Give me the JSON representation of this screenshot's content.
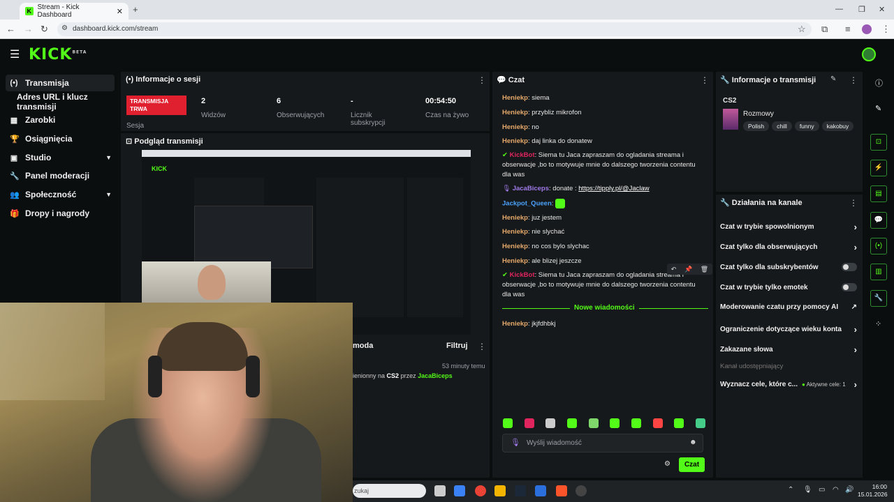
{
  "browser": {
    "tab_title": "Stream - Kick Dashboard",
    "url": "dashboard.kick.com/stream"
  },
  "brand": {
    "logo": "KICK",
    "badge": "BETA",
    "accent": "#53fc18"
  },
  "sidebar": {
    "items": [
      {
        "label": "Transmisja",
        "icon": "broadcast-icon"
      },
      {
        "label": "Adres URL i klucz transmisji"
      },
      {
        "label": "Zarobki",
        "icon": "earnings-icon"
      },
      {
        "label": "Osiągnięcia",
        "icon": "trophy-icon"
      },
      {
        "label": "Studio",
        "icon": "studio-icon"
      },
      {
        "label": "Panel moderacji",
        "icon": "wrench-icon"
      },
      {
        "label": "Społeczność",
        "icon": "people-icon"
      },
      {
        "label": "Dropy i nagrody",
        "icon": "gift-icon"
      }
    ]
  },
  "session": {
    "title": "Informacje o sesji",
    "live_badge": "TRANSMISJA TRWA",
    "session_label": "Sesja",
    "stats": [
      {
        "value": "2",
        "label": "Widzów"
      },
      {
        "value": "6",
        "label": "Obserwujących"
      },
      {
        "value": "-",
        "label": "Licznik subskrypcji"
      },
      {
        "value": "00:54:50",
        "label": "Czas na żywo"
      }
    ]
  },
  "preview": {
    "title": "Podgląd transmisji"
  },
  "feed": {
    "title_fragment": "moda",
    "filter_label": "Filtruj",
    "time": "53 minuty temu",
    "text_pre": "ienionny na ",
    "game": "CS2",
    "mid": " przez ",
    "user": "JacaBiceps"
  },
  "chat": {
    "title": "Czat",
    "messages": [
      {
        "user": "Heniekp",
        "text": "siema"
      },
      {
        "user": "Heniekp",
        "text": "przybliz mikrofon"
      },
      {
        "user": "Heniekp",
        "text": "no"
      },
      {
        "user": "Heniekp",
        "text": "daj linka do donatew"
      },
      {
        "user": "KickBot",
        "text": "Siema tu Jaca zapraszam do ogladania streama i obserwacje ,bo to motywuje mnie do dalszego tworzenia contentu dla was"
      },
      {
        "user": "JacaBiceps",
        "text": "donate :",
        "link": "https://tipply.pl/@Jaclaw"
      },
      {
        "user": "Jackpot_Queen",
        "text": ""
      },
      {
        "user": "Heniekp",
        "text": "juz jestem"
      },
      {
        "user": "Heniekp",
        "text": "nie slychać"
      },
      {
        "user": "Heniekp",
        "text": "no cos bylo slychac"
      },
      {
        "user": "Heniekp",
        "text": "ale blizej jeszcze"
      },
      {
        "user": "KickBot",
        "text": "Siema tu Jaca zapraszam do ogladania streama i obserwacje ,bo to motywuje mnie do dalszego tworzenia contentu dla was"
      },
      {
        "user": "Heniekp",
        "text": "jkjfdhbkj"
      }
    ],
    "new_messages": "Nowe wiadomości",
    "placeholder": "Wyślij wiadomość",
    "send_label": "Czat"
  },
  "stream_info": {
    "title": "Informacje o transmisji",
    "game": "CS2",
    "category": "Rozmowy",
    "tags": [
      "Polish",
      "chill",
      "funny",
      "kakobuy"
    ]
  },
  "channel_actions": {
    "title": "Działania na kanale",
    "items": [
      {
        "label": "Czat w trybie spowolnionym",
        "control": "arrow"
      },
      {
        "label": "Czat tylko dla obserwujących",
        "control": "arrow"
      },
      {
        "label": "Czat tylko dla subskrybentów",
        "control": "toggle"
      },
      {
        "label": "Czat w trybie tylko emotek",
        "control": "toggle"
      },
      {
        "label": "Moderowanie czatu przy pomocy AI",
        "control": "external"
      },
      {
        "label": "Ograniczenie dotyczące wieku konta",
        "control": "arrow"
      },
      {
        "label": "Zakazane słowa",
        "control": "arrow"
      }
    ],
    "shared_label": "Kanał udostępniający",
    "goals_label": "Wyznacz cele, które c...",
    "active_goals": "Aktywne cele: 1"
  },
  "taskbar": {
    "search_text": "zukaj",
    "time": "16:00",
    "date": "15.01.2026"
  }
}
